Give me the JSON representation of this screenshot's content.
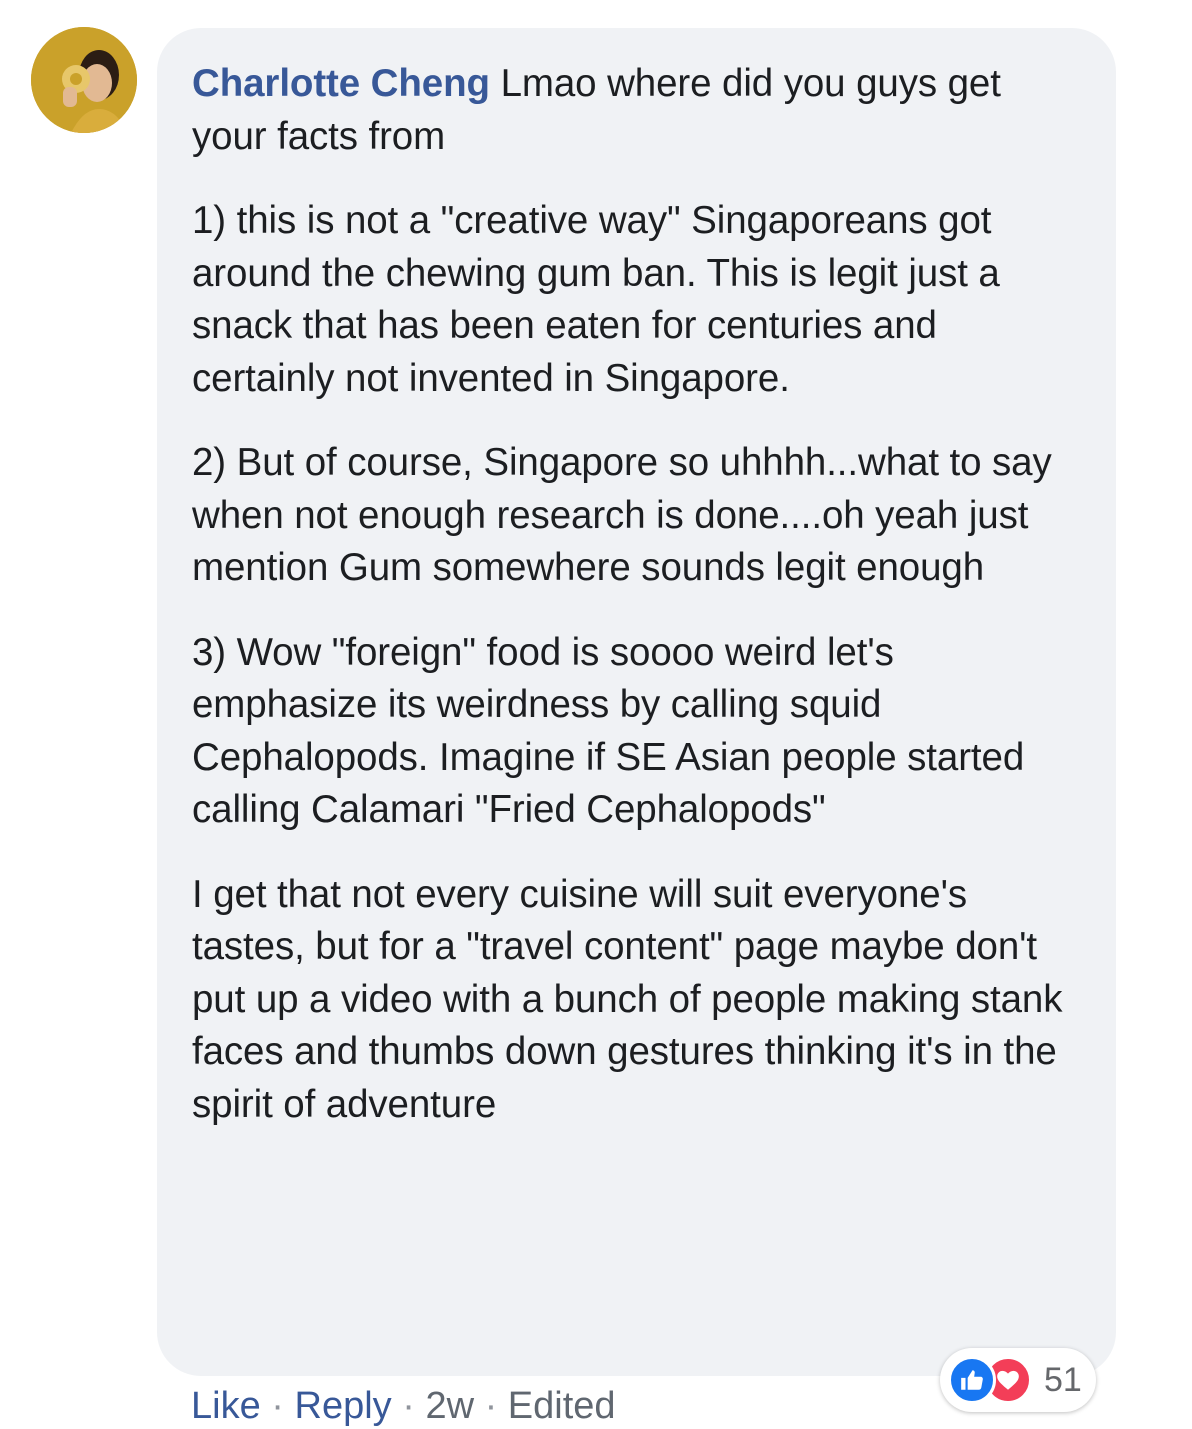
{
  "comment": {
    "author": "Charlotte Cheng",
    "paragraphs": [
      "Lmao where did you guys get your facts from",
      "1) this is not a \"creative way\" Singaporeans got around the chewing gum ban. This is legit just a snack that has been eaten for centuries and certainly not invented in Singapore.",
      "2) But of course, Singapore so uhhhh...what to say when not enough research is done....oh yeah just mention Gum somewhere sounds legit enough",
      "3) Wow \"foreign\" food is soooo weird let's emphasize its weirdness by calling squid Cephalopods. Imagine if SE Asian people started calling Calamari \"Fried Cephalopods\"",
      "I get that not every cuisine will suit everyone's tastes, but for a \"travel content\" page maybe don't put up a video with a bunch of people making stank faces and thumbs down gestures thinking it's in the spirit of adventure"
    ]
  },
  "reactions": {
    "icons": [
      "like-icon",
      "love-icon"
    ],
    "count": "51"
  },
  "actions": {
    "like": "Like",
    "reply": "Reply",
    "time": "2w",
    "edited": "Edited",
    "separator": "·"
  },
  "colors": {
    "author_link": "#385898",
    "bubble_bg": "#f0f2f5",
    "like_blue": "#1877f2",
    "love_red": "#f33e58"
  }
}
